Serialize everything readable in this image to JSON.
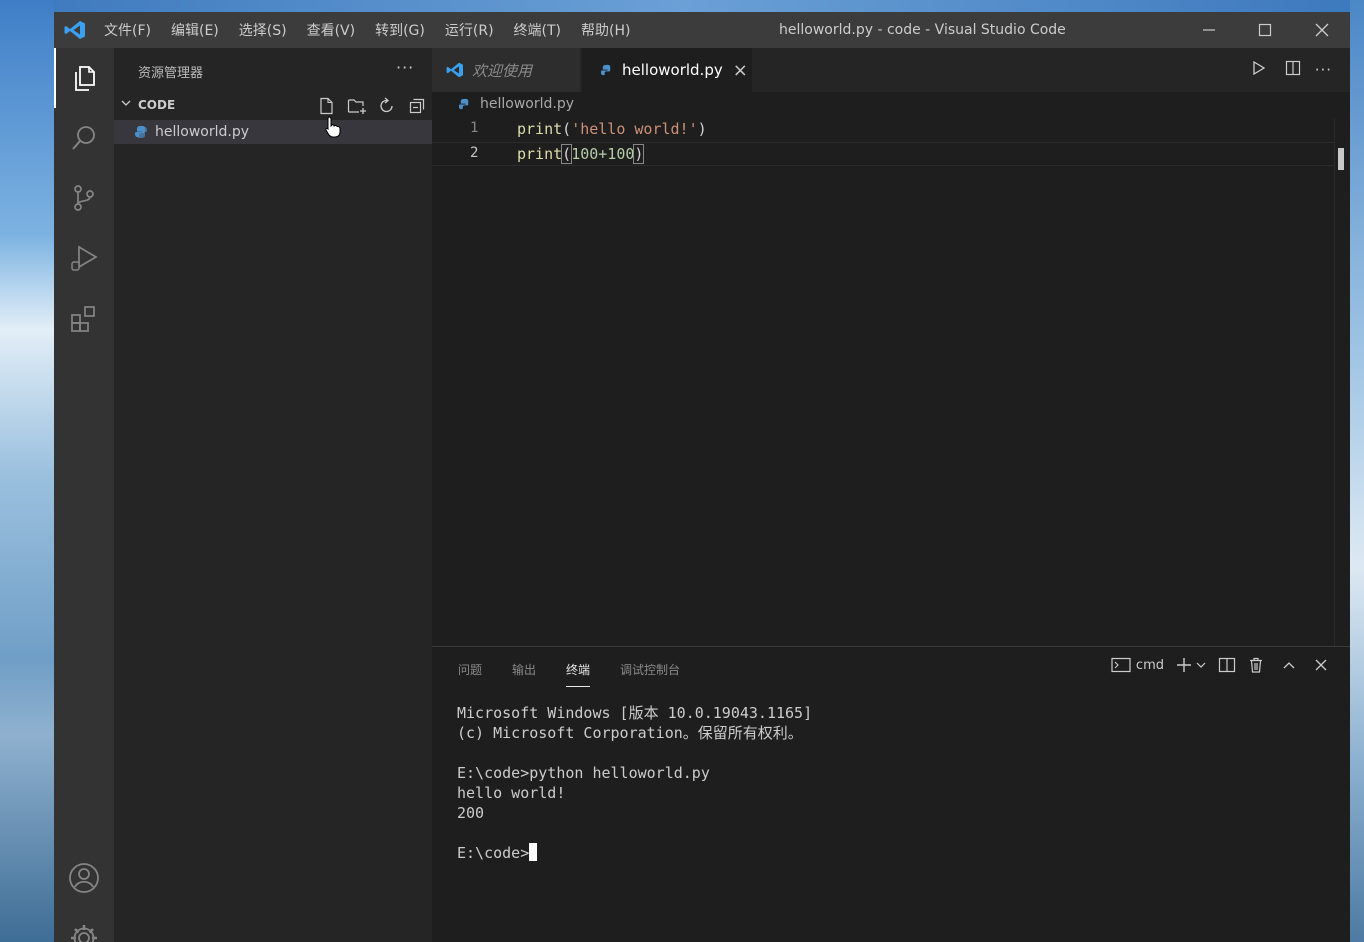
{
  "window": {
    "title": "helloworld.py - code - Visual Studio Code",
    "menu": [
      "文件(F)",
      "编辑(E)",
      "选择(S)",
      "查看(V)",
      "转到(G)",
      "运行(R)",
      "终端(T)",
      "帮助(H)"
    ],
    "controls": [
      "minimize-icon",
      "maximize-icon",
      "close-icon"
    ]
  },
  "activitybar": [
    "explorer-icon",
    "search-icon",
    "source-control-icon",
    "run-debug-icon",
    "extensions-icon",
    "account-icon",
    "settings-gear-icon"
  ],
  "sidebar": {
    "title": "资源管理器",
    "more": "···",
    "section": "CODE",
    "section_actions": [
      "new-file-icon",
      "new-folder-icon",
      "refresh-icon",
      "collapse-all-icon"
    ],
    "files": [
      {
        "name": "helloworld.py"
      }
    ]
  },
  "tabs": [
    {
      "label": "欢迎使用",
      "active": false
    },
    {
      "label": "helloworld.py",
      "active": true,
      "close": "×"
    }
  ],
  "breadcrumb": "helloworld.py",
  "editor": {
    "lines": [
      {
        "number": "1",
        "fn": "print",
        "open": "(",
        "arg": "'hello world!'",
        "close": ")"
      },
      {
        "number": "2",
        "fn": "print",
        "open": "(",
        "arg": "100+100",
        "close": ")"
      }
    ]
  },
  "panel": {
    "tabs": [
      "问题",
      "输出",
      "终端",
      "调试控制台"
    ],
    "active_tab": "终端",
    "shell": "cmd",
    "terminal": [
      "Microsoft Windows [版本 10.0.19043.1165]",
      "(c) Microsoft Corporation。保留所有权利。",
      "",
      "E:\\code>python helloworld.py",
      "hello world!",
      "200",
      "",
      "E:\\code>"
    ]
  },
  "colors": {
    "accent": "#007acc",
    "titlebar": "#3c3c3c",
    "activitybar": "#333333",
    "sidebar": "#252526",
    "editor": "#1e1e1e",
    "string": "#ce9178",
    "function": "#dcdcaa"
  }
}
